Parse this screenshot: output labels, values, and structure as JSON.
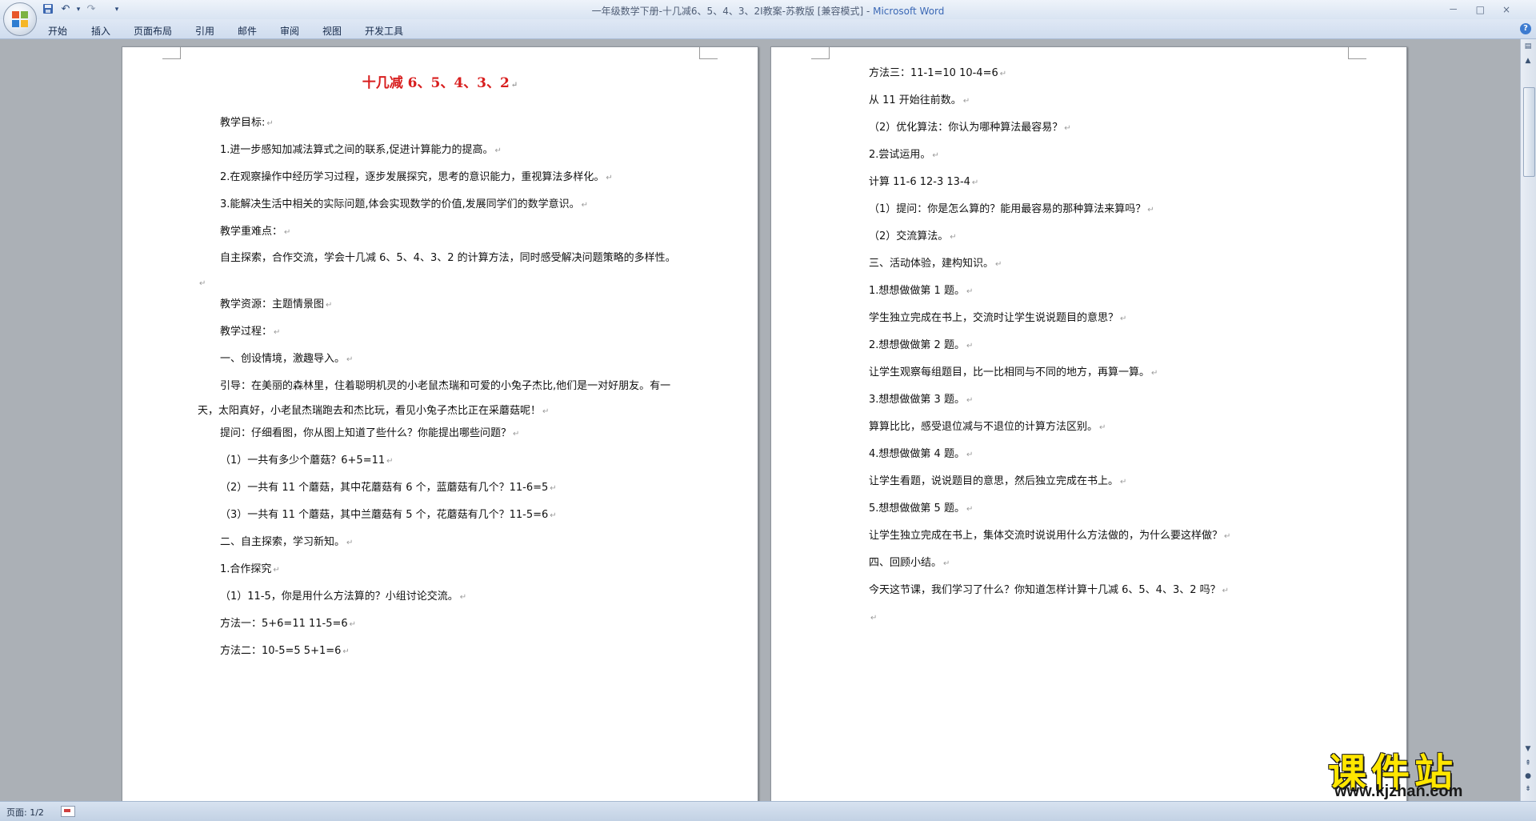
{
  "window": {
    "title": "一年级数学下册-十几减6、5、4、3、2I教案-苏教版 [兼容模式] - ",
    "app_name": "Microsoft Word",
    "controls": [
      "－",
      "□",
      "×"
    ]
  },
  "quick_access": {
    "save_icon": "save-icon",
    "undo_icon": "undo-icon",
    "redo_icon": "redo-icon",
    "customize_icon": "customize-qat-icon"
  },
  "ribbon_tabs": [
    "开始",
    "插入",
    "页面布局",
    "引用",
    "邮件",
    "审阅",
    "视图",
    "开发工具"
  ],
  "help_label": "?",
  "page1": {
    "title": "十几减 6、5、4、3、2",
    "paragraphs": [
      "教学目标:",
      "1.进一步感知加减法算式之间的联系,促进计算能力的提高。",
      "2.在观察操作中经历学习过程，逐步发展探究，思考的意识能力，重视算法多样化。",
      "3.能解决生活中相关的实际问题,体会实现数学的价值,发展同学们的数学意识。",
      "教学重难点：",
      "自主探索，合作交流，学会十几减 6、5、4、3、2 的计算方法，同时感受解决问题策略的多样性。",
      "教学资源：主题情景图",
      "教学过程：",
      "一、创设情境，激趣导入。",
      "引导：在美丽的森林里，住着聪明机灵的小老鼠杰瑞和可爱的小兔子杰比,他们是一对好朋友。有一天，太阳真好，小老鼠杰瑞跑去和杰比玩，看见小兔子杰比正在采蘑菇呢！",
      "提问：仔细看图，你从图上知道了些什么？你能提出哪些问题？",
      "（1）一共有多少个蘑菇？6+5=11",
      "（2）一共有 11 个蘑菇，其中花蘑菇有 6 个，蓝蘑菇有几个？11-6=5",
      "（3）一共有 11 个蘑菇，其中兰蘑菇有 5 个，花蘑菇有几个？11-5=6",
      "二、自主探索，学习新知。",
      "1.合作探究",
      "（1）11-5，你是用什么方法算的？小组讨论交流。",
      "方法一：5+6=11      11-5=6",
      "方法二：10-5=5      5+1=6"
    ]
  },
  "page2": {
    "paragraphs": [
      "方法三：11-1=10      10-4=6",
      "从 11 开始往前数。",
      "（2）优化算法：你认为哪种算法最容易？",
      "2.尝试运用。",
      "计算 11-6        12-3      13-4",
      "（1）提问：你是怎么算的？能用最容易的那种算法来算吗？",
      "（2）交流算法。",
      "三、活动体验，建构知识。",
      "1.想想做做第 1 题。",
      "学生独立完成在书上，交流时让学生说说题目的意思？",
      "2.想想做做第 2 题。",
      "让学生观察每组题目，比一比相同与不同的地方，再算一算。",
      "3.想想做做第 3 题。",
      "算算比比，感受退位减与不退位的计算方法区别。",
      "4.想想做做第 4 题。",
      "让学生看题，说说题目的意思，然后独立完成在书上。",
      "5.想想做做第 5 题。",
      "让学生独立完成在书上，集体交流时说说用什么方法做的，为什么要这样做？",
      "四、回顾小结。",
      "今天这节课，我们学习了什么？你知道怎样计算十几减 6、5、4、3、2 吗？",
      ""
    ]
  },
  "paragraph_mark": "↵",
  "status": {
    "page": "页面: 1/2"
  },
  "watermark": {
    "main": "课件站",
    "url": "www.kjzhan.com"
  },
  "colors": {
    "title_red": "#d81e1e",
    "watermark_yellow": "#ffe600",
    "app_blue": "#3b68b5"
  }
}
